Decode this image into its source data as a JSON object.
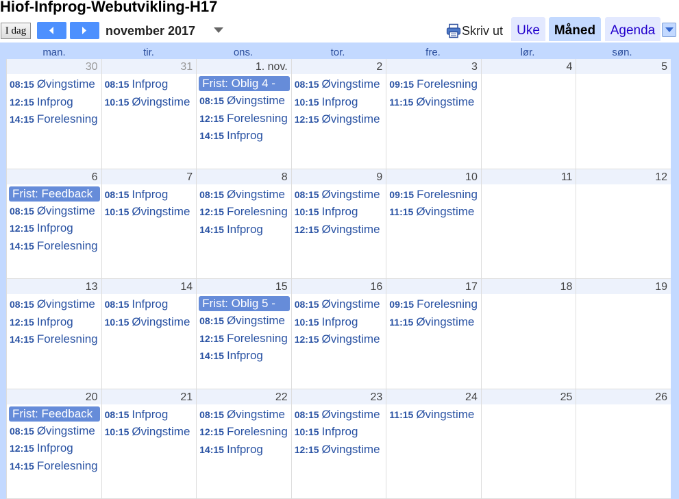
{
  "calendar_title": "Hiof-Infprog-Webutvikling-H17",
  "toolbar": {
    "today_label": "I dag",
    "month_label": "november 2017",
    "print_label": "Skriv ut",
    "views": [
      "Uke",
      "Måned",
      "Agenda"
    ],
    "active_view": "Måned"
  },
  "weekdays": [
    "man.",
    "tir.",
    "ons.",
    "tor.",
    "fre.",
    "lør.",
    "søn."
  ],
  "weeks": [
    [
      {
        "label": "30",
        "other": true,
        "events": [
          {
            "time": "08:15",
            "title": "Øvingstime"
          },
          {
            "time": "12:15",
            "title": "Infprog"
          },
          {
            "time": "14:15",
            "title": "Forelesning"
          }
        ]
      },
      {
        "label": "31",
        "other": true,
        "events": [
          {
            "time": "08:15",
            "title": "Infprog"
          },
          {
            "time": "10:15",
            "title": "Øvingstime"
          }
        ]
      },
      {
        "label": "1. nov.",
        "allday": "Frist: Oblig 4 -",
        "events": [
          {
            "time": "08:15",
            "title": "Øvingstime"
          },
          {
            "time": "12:15",
            "title": "Forelesning"
          },
          {
            "time": "14:15",
            "title": "Infprog"
          }
        ]
      },
      {
        "label": "2",
        "events": [
          {
            "time": "08:15",
            "title": "Øvingstime"
          },
          {
            "time": "10:15",
            "title": "Infprog"
          },
          {
            "time": "12:15",
            "title": "Øvingstime"
          }
        ]
      },
      {
        "label": "3",
        "events": [
          {
            "time": "09:15",
            "title": "Forelesning"
          },
          {
            "time": "11:15",
            "title": "Øvingstime"
          }
        ]
      },
      {
        "label": "4",
        "events": []
      },
      {
        "label": "5",
        "events": []
      }
    ],
    [
      {
        "label": "6",
        "allday": "Frist: Feedback",
        "events": [
          {
            "time": "08:15",
            "title": "Øvingstime"
          },
          {
            "time": "12:15",
            "title": "Infprog"
          },
          {
            "time": "14:15",
            "title": "Forelesning"
          }
        ]
      },
      {
        "label": "7",
        "events": [
          {
            "time": "08:15",
            "title": "Infprog"
          },
          {
            "time": "10:15",
            "title": "Øvingstime"
          }
        ]
      },
      {
        "label": "8",
        "events": [
          {
            "time": "08:15",
            "title": "Øvingstime"
          },
          {
            "time": "12:15",
            "title": "Forelesning"
          },
          {
            "time": "14:15",
            "title": "Infprog"
          }
        ]
      },
      {
        "label": "9",
        "events": [
          {
            "time": "08:15",
            "title": "Øvingstime"
          },
          {
            "time": "10:15",
            "title": "Infprog"
          },
          {
            "time": "12:15",
            "title": "Øvingstime"
          }
        ]
      },
      {
        "label": "10",
        "events": [
          {
            "time": "09:15",
            "title": "Forelesning"
          },
          {
            "time": "11:15",
            "title": "Øvingstime"
          }
        ]
      },
      {
        "label": "11",
        "events": []
      },
      {
        "label": "12",
        "events": []
      }
    ],
    [
      {
        "label": "13",
        "events": [
          {
            "time": "08:15",
            "title": "Øvingstime"
          },
          {
            "time": "12:15",
            "title": "Infprog"
          },
          {
            "time": "14:15",
            "title": "Forelesning"
          }
        ]
      },
      {
        "label": "14",
        "events": [
          {
            "time": "08:15",
            "title": "Infprog"
          },
          {
            "time": "10:15",
            "title": "Øvingstime"
          }
        ]
      },
      {
        "label": "15",
        "allday": "Frist: Oblig 5 -",
        "events": [
          {
            "time": "08:15",
            "title": "Øvingstime"
          },
          {
            "time": "12:15",
            "title": "Forelesning"
          },
          {
            "time": "14:15",
            "title": "Infprog"
          }
        ]
      },
      {
        "label": "16",
        "events": [
          {
            "time": "08:15",
            "title": "Øvingstime"
          },
          {
            "time": "10:15",
            "title": "Infprog"
          },
          {
            "time": "12:15",
            "title": "Øvingstime"
          }
        ]
      },
      {
        "label": "17",
        "events": [
          {
            "time": "09:15",
            "title": "Forelesning"
          },
          {
            "time": "11:15",
            "title": "Øvingstime"
          }
        ]
      },
      {
        "label": "18",
        "events": []
      },
      {
        "label": "19",
        "events": []
      }
    ],
    [
      {
        "label": "20",
        "allday": "Frist: Feedback",
        "events": [
          {
            "time": "08:15",
            "title": "Øvingstime"
          },
          {
            "time": "12:15",
            "title": "Infprog"
          },
          {
            "time": "14:15",
            "title": "Forelesning"
          }
        ]
      },
      {
        "label": "21",
        "events": [
          {
            "time": "08:15",
            "title": "Infprog"
          },
          {
            "time": "10:15",
            "title": "Øvingstime"
          }
        ]
      },
      {
        "label": "22",
        "events": [
          {
            "time": "08:15",
            "title": "Øvingstime"
          },
          {
            "time": "12:15",
            "title": "Forelesning"
          },
          {
            "time": "14:15",
            "title": "Infprog"
          }
        ]
      },
      {
        "label": "23",
        "events": [
          {
            "time": "08:15",
            "title": "Øvingstime"
          },
          {
            "time": "10:15",
            "title": "Infprog"
          },
          {
            "time": "12:15",
            "title": "Øvingstime"
          }
        ]
      },
      {
        "label": "24",
        "events": [
          {
            "time": "11:15",
            "title": "Øvingstime"
          }
        ]
      },
      {
        "label": "25",
        "events": []
      },
      {
        "label": "26",
        "events": []
      }
    ]
  ]
}
